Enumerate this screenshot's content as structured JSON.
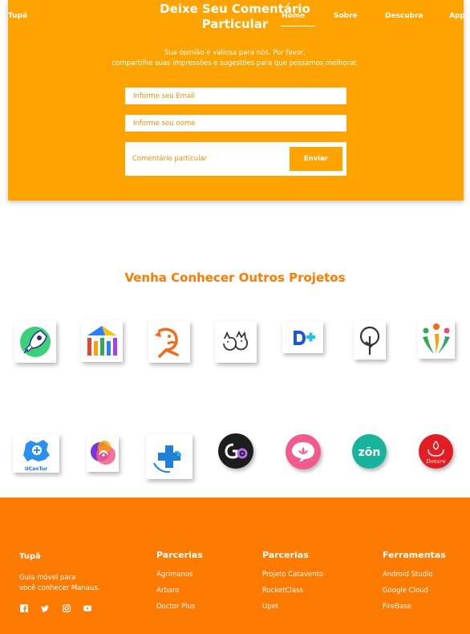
{
  "nav": {
    "brand": "Tupã",
    "links": [
      "Home",
      "Sobre",
      "Descubra",
      "App"
    ]
  },
  "comment": {
    "title_line1": "Deixe Seu Comentário",
    "title_line2": "Particular",
    "subtitle_line1": "Sua opinião é valiosa para nós. Por favor,",
    "subtitle_line2": "compartilhe suas impressões e sugestões para que possamos melhorar.",
    "email_placeholder": "Informe seu Email",
    "name_placeholder": "Informe seu nome",
    "comment_placeholder": "Comentário particular",
    "send_label": "Enviar"
  },
  "projects": {
    "title": "Venha Conhecer Outros Projetos",
    "ucantur_label": "UCanTur",
    "donare_label": "Donare",
    "zon_label": "zōn",
    "logos": [
      "rocket-app-logo",
      "bar-columns-logo",
      "orange-bird-logo",
      "pets-logo",
      "d-plus-logo",
      "tree-logo",
      "people-logo",
      "ucantur-logo",
      "podcast-logo",
      "health-plus-logo",
      "go-gear-logo",
      "chat-lotus-logo",
      "zon-logo",
      "donare-logo"
    ]
  },
  "footer": {
    "brand": "Tupã",
    "tagline_line1": "Guia móvel para",
    "tagline_line2": "você conhecer Manaus.",
    "social": [
      "facebook-icon",
      "twitter-icon",
      "instagram-icon",
      "youtube-icon"
    ],
    "columns": [
      {
        "title": "Parcerias",
        "links": [
          "Agrimanos",
          "Arbaro",
          "Doctor Plus"
        ]
      },
      {
        "title": "Parcerias",
        "links": [
          "Projeto Catavento",
          "RocketClass",
          "Upet"
        ]
      },
      {
        "title": "Ferramentas",
        "links": [
          "Android Studio",
          "Google Cloud",
          "FireBase"
        ]
      }
    ]
  },
  "colors": {
    "orange": "#ffa300",
    "deep_orange": "#ff7a00",
    "white": "#ffffff"
  }
}
